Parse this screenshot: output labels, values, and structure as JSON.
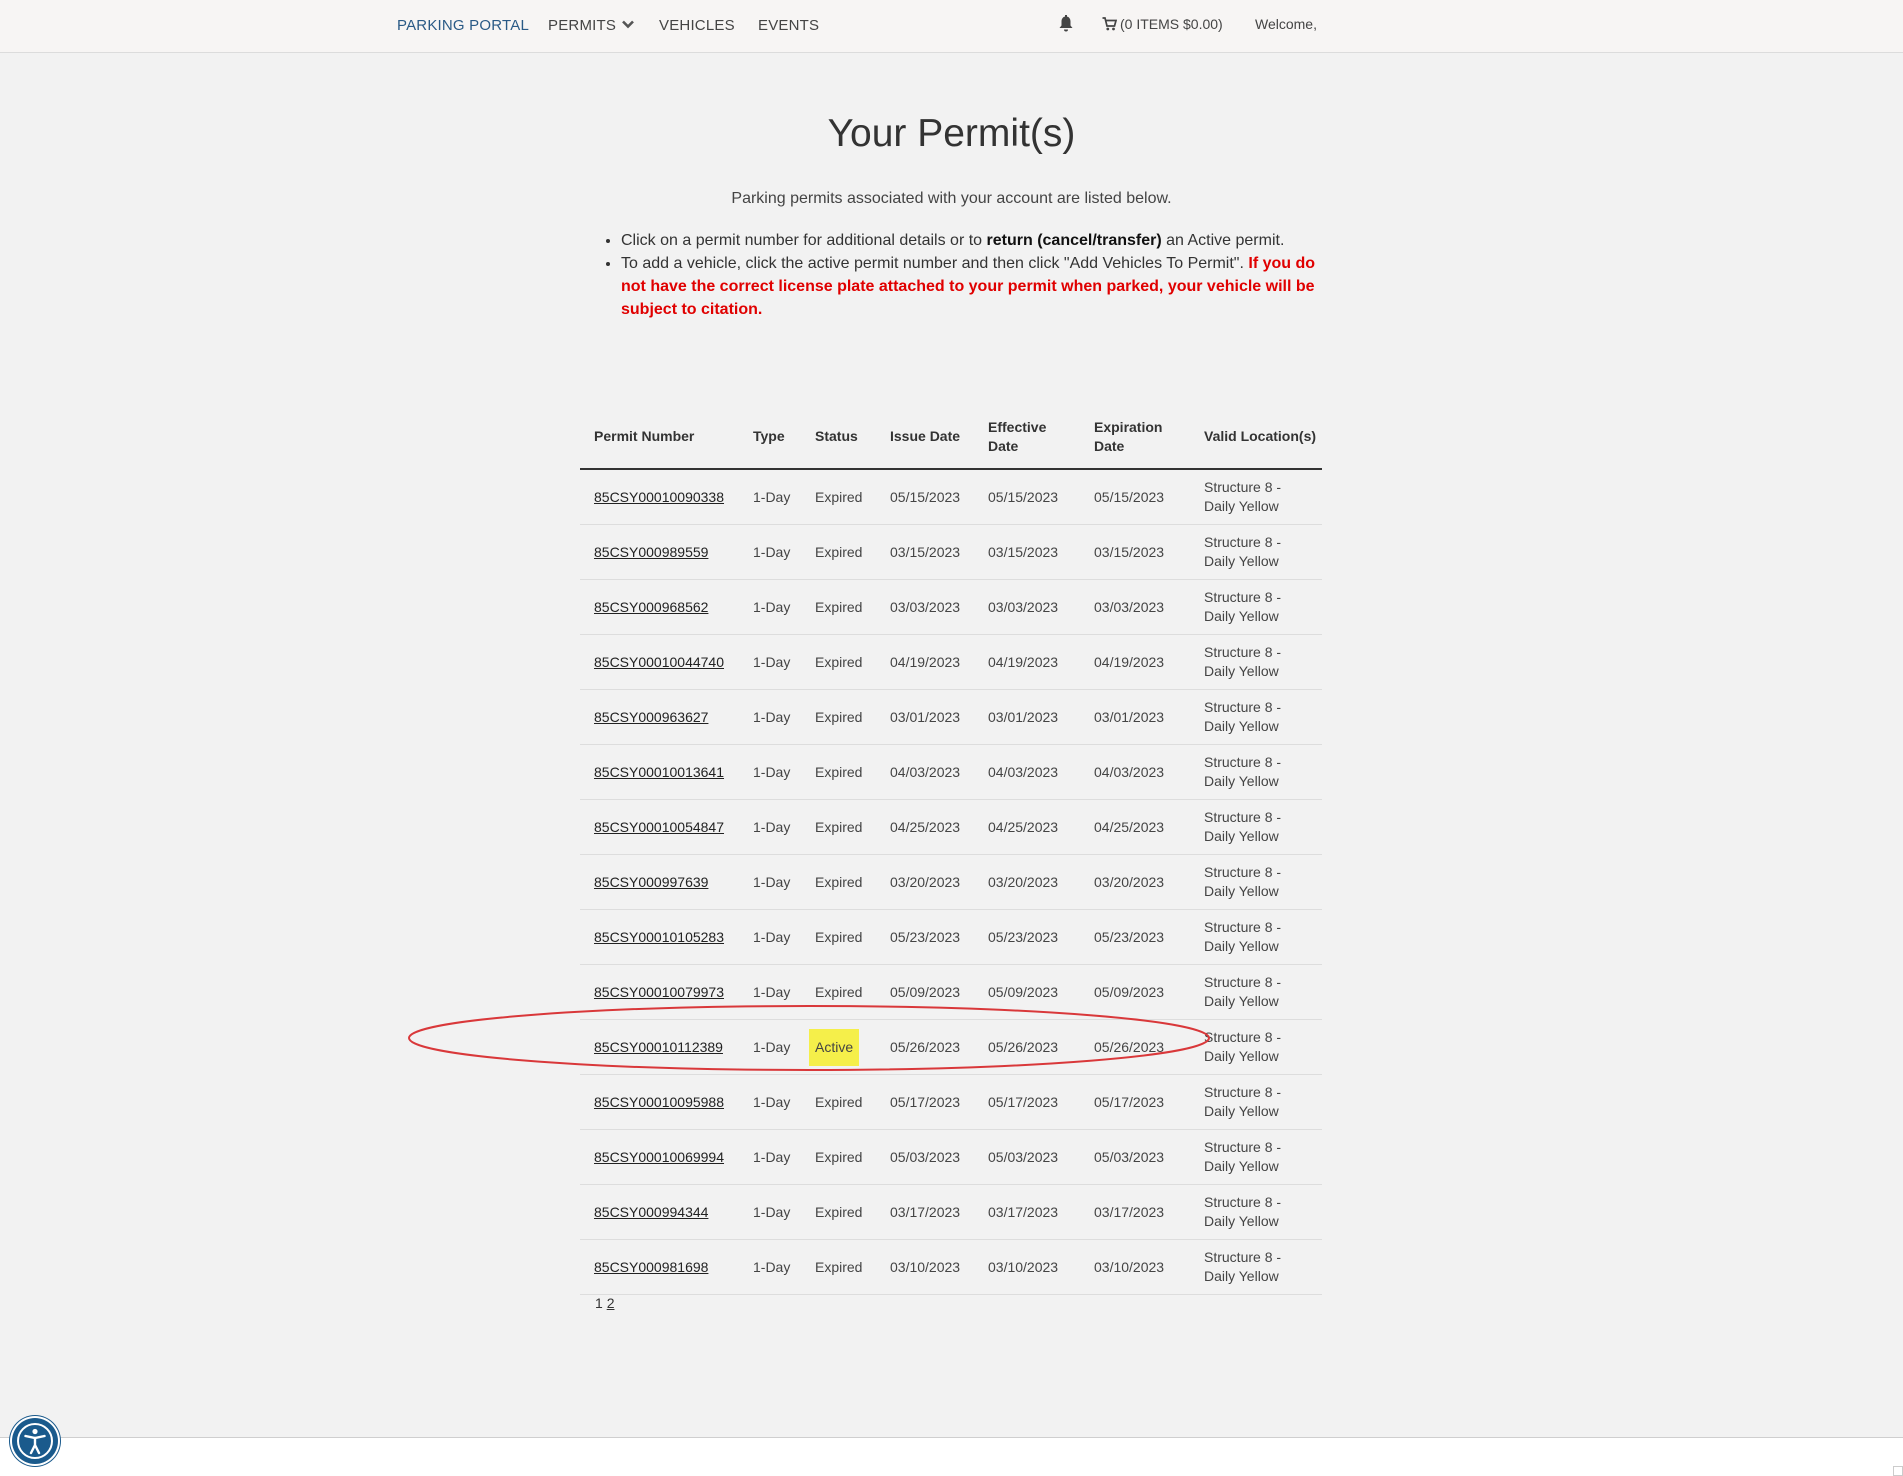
{
  "nav": {
    "brand": "PARKING PORTAL",
    "permits": "PERMITS",
    "vehicles": "VEHICLES",
    "events": "EVENTS",
    "cart": "(0 ITEMS $0.00)",
    "welcome": "Welcome,"
  },
  "page": {
    "title": "Your Permit(s)",
    "intro": "Parking permits associated with your account are listed below.",
    "bullet1_pre": "Click on a permit number for additional details or to ",
    "bullet1_bold": "return (cancel/transfer)",
    "bullet1_post": " an Active permit.",
    "bullet2_pre": "To add a vehicle, click the active permit number and then click \"Add Vehicles To Permit\". ",
    "bullet2_warn": "If you do not have the correct license plate attached to your permit when parked, your vehicle will be subject to citation."
  },
  "table": {
    "headers": [
      "Permit Number",
      "Type",
      "Status",
      "Issue Date",
      "Effective Date",
      "Expiration Date",
      "Valid Location(s)"
    ],
    "rows": [
      {
        "permit": "85CSY00010090338",
        "type": "1-Day",
        "status": "Expired",
        "issue": "05/15/2023",
        "effective": "05/15/2023",
        "expiration": "05/15/2023",
        "location": "Structure 8 - Daily Yellow"
      },
      {
        "permit": "85CSY000989559",
        "type": "1-Day",
        "status": "Expired",
        "issue": "03/15/2023",
        "effective": "03/15/2023",
        "expiration": "03/15/2023",
        "location": "Structure 8 - Daily Yellow"
      },
      {
        "permit": "85CSY000968562",
        "type": "1-Day",
        "status": "Expired",
        "issue": "03/03/2023",
        "effective": "03/03/2023",
        "expiration": "03/03/2023",
        "location": "Structure 8 - Daily Yellow"
      },
      {
        "permit": "85CSY00010044740",
        "type": "1-Day",
        "status": "Expired",
        "issue": "04/19/2023",
        "effective": "04/19/2023",
        "expiration": "04/19/2023",
        "location": "Structure 8 - Daily Yellow"
      },
      {
        "permit": "85CSY000963627",
        "type": "1-Day",
        "status": "Expired",
        "issue": "03/01/2023",
        "effective": "03/01/2023",
        "expiration": "03/01/2023",
        "location": "Structure 8 - Daily Yellow"
      },
      {
        "permit": "85CSY00010013641",
        "type": "1-Day",
        "status": "Expired",
        "issue": "04/03/2023",
        "effective": "04/03/2023",
        "expiration": "04/03/2023",
        "location": "Structure 8 - Daily Yellow"
      },
      {
        "permit": "85CSY00010054847",
        "type": "1-Day",
        "status": "Expired",
        "issue": "04/25/2023",
        "effective": "04/25/2023",
        "expiration": "04/25/2023",
        "location": "Structure 8 - Daily Yellow"
      },
      {
        "permit": "85CSY000997639",
        "type": "1-Day",
        "status": "Expired",
        "issue": "03/20/2023",
        "effective": "03/20/2023",
        "expiration": "03/20/2023",
        "location": "Structure 8 - Daily Yellow"
      },
      {
        "permit": "85CSY00010105283",
        "type": "1-Day",
        "status": "Expired",
        "issue": "05/23/2023",
        "effective": "05/23/2023",
        "expiration": "05/23/2023",
        "location": "Structure 8 - Daily Yellow"
      },
      {
        "permit": "85CSY00010079973",
        "type": "1-Day",
        "status": "Expired",
        "issue": "05/09/2023",
        "effective": "05/09/2023",
        "expiration": "05/09/2023",
        "location": "Structure 8 - Daily Yellow"
      },
      {
        "permit": "85CSY00010112389",
        "type": "1-Day",
        "status": "Active",
        "issue": "05/26/2023",
        "effective": "05/26/2023",
        "expiration": "05/26/2023",
        "location": "Structure 8 - Daily Yellow",
        "highlight": true
      },
      {
        "permit": "85CSY00010095988",
        "type": "1-Day",
        "status": "Expired",
        "issue": "05/17/2023",
        "effective": "05/17/2023",
        "expiration": "05/17/2023",
        "location": "Structure 8 - Daily Yellow"
      },
      {
        "permit": "85CSY00010069994",
        "type": "1-Day",
        "status": "Expired",
        "issue": "05/03/2023",
        "effective": "05/03/2023",
        "expiration": "05/03/2023",
        "location": "Structure 8 - Daily Yellow"
      },
      {
        "permit": "85CSY000994344",
        "type": "1-Day",
        "status": "Expired",
        "issue": "03/17/2023",
        "effective": "03/17/2023",
        "expiration": "03/17/2023",
        "location": "Structure 8 - Daily Yellow"
      },
      {
        "permit": "85CSY000981698",
        "type": "1-Day",
        "status": "Expired",
        "issue": "03/10/2023",
        "effective": "03/10/2023",
        "expiration": "03/10/2023",
        "location": "Structure 8 - Daily Yellow"
      }
    ]
  },
  "pagination": {
    "current": "1",
    "next": "2"
  },
  "colors": {
    "highlight": "#f5ef4a",
    "annotation": "#d9383a",
    "warning": "#e00000",
    "brand": "#2a5a86"
  },
  "icons": {
    "bell": "bell-icon",
    "cart": "cart-icon",
    "chevron": "chevron-down-icon",
    "accessibility": "accessibility-icon"
  }
}
